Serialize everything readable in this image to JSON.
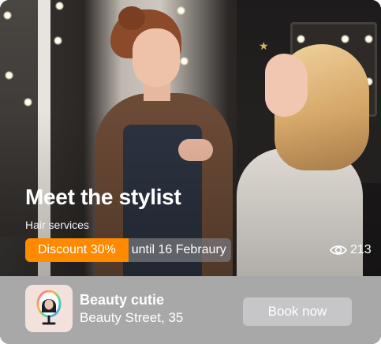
{
  "card": {
    "title": "Meet the stylist",
    "category": "Hair services",
    "discount_label": "Discount 30%",
    "validity_label": "until 16 Febraury",
    "views_count": "213",
    "views_icon": "eye-icon"
  },
  "business": {
    "logo_icon": "mirror-portrait-logo",
    "name": "Beauty cutie",
    "address": "Beauty Street, 35",
    "cta_label": "Book now"
  },
  "colors": {
    "discount_bg": "#ff8a00",
    "bottom_bar_bg": "#a8a8a8",
    "button_bg": "#c6c6c8",
    "logo_bg": "#f3e2dc"
  }
}
